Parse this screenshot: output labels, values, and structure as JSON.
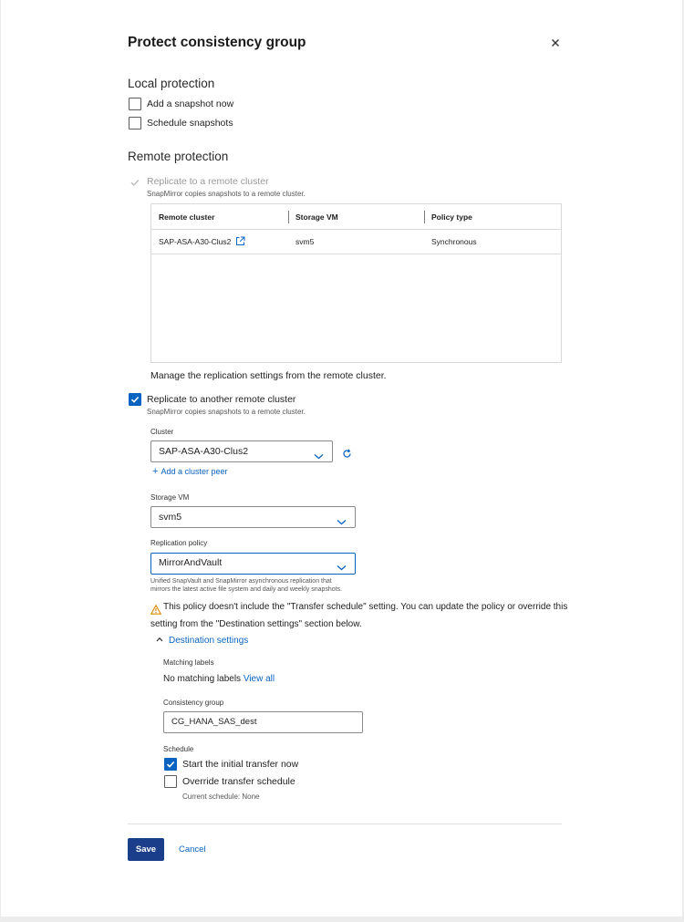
{
  "dialog": {
    "title": "Protect consistency group"
  },
  "local_protection": {
    "heading": "Local protection",
    "add_snapshot_label": "Add a snapshot now",
    "add_snapshot_checked": false,
    "schedule_snapshots_label": "Schedule snapshots",
    "schedule_snapshots_checked": false
  },
  "remote_protection": {
    "heading": "Remote protection",
    "replicate_label": "Replicate to a remote cluster",
    "replicate_sub": "SnapMirror copies snapshots to a remote cluster.",
    "table": {
      "columns": [
        "Remote cluster",
        "Storage VM",
        "Policy type"
      ],
      "rows": [
        {
          "remote_cluster": "SAP-ASA-A30-Clus2",
          "storage_vm": "svm5",
          "policy_type": "Synchronous"
        }
      ]
    },
    "manage_note": "Manage the replication settings from the remote cluster.",
    "replicate_another_label": "Replicate to another remote cluster",
    "replicate_another_checked": true,
    "replicate_another_sub": "SnapMirror copies snapshots to a remote cluster.",
    "cluster_label": "Cluster",
    "cluster_value": "SAP-ASA-A30-Clus2",
    "add_peer_label": "Add a cluster peer",
    "svm_label": "Storage VM",
    "svm_value": "svm5",
    "policy_label": "Replication policy",
    "policy_value": "MirrorAndVault",
    "policy_desc_1": "Unified SnapVault and SnapMirror asynchronous replication that",
    "policy_desc_2": "mirrors the latest active file system and daily and weekly snapshots.",
    "warning_line_1": "This policy doesn't include the \"Transfer schedule\" setting. You can update the policy or override this",
    "warning_line_2": "setting from the \"Destination settings\" section below.",
    "warning_color": "#e08600"
  },
  "destination": {
    "toggle_label": "Destination settings",
    "matching_labels_label": "Matching labels",
    "matching_labels_value": "No matching labels",
    "view_all_label": "View all",
    "cg_label": "Consistency group",
    "cg_value": "CG_HANA_SAS_dest",
    "schedule_label": "Schedule",
    "start_transfer_label": "Start the initial transfer now",
    "start_transfer_checked": true,
    "override_label": "Override transfer schedule",
    "override_checked": false,
    "current_schedule": "Current schedule: None"
  },
  "footer": {
    "save_label": "Save",
    "cancel_label": "Cancel"
  },
  "colors": {
    "accent": "#0b63c1",
    "save_button": "#1b3e8a"
  }
}
